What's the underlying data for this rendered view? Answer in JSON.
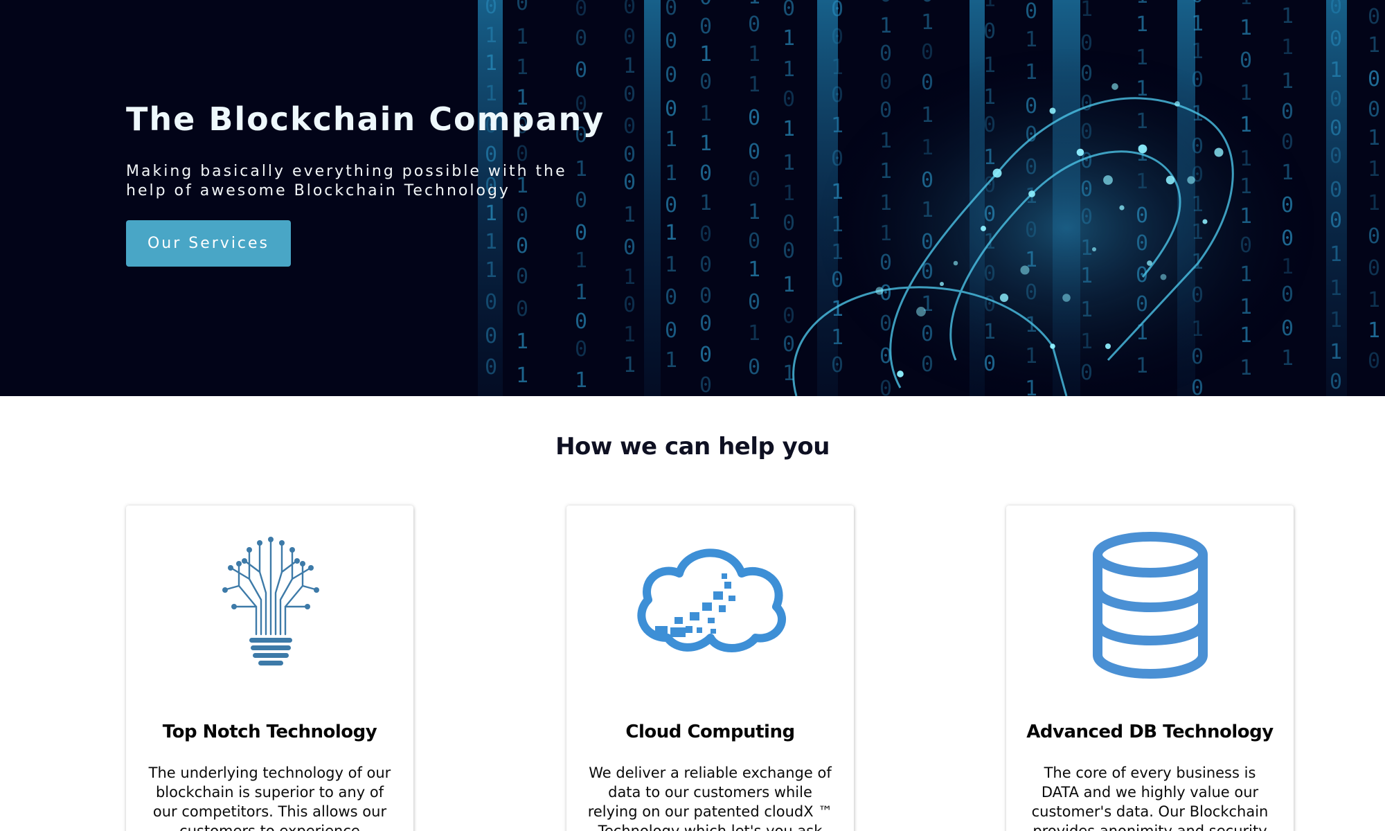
{
  "hero": {
    "title": "The Blockchain Company",
    "subtitle": "Making basically everything possible with the help of awesome Blockchain Technology",
    "button_label": "Our Services"
  },
  "services": {
    "heading": "How we can help you",
    "cards": [
      {
        "icon": "lightbulb-circuit-icon",
        "title": "Top Notch Technology",
        "text": "The underlying technology of our blockchain is superior to any of our competitors. This allows our customers to experience"
      },
      {
        "icon": "cloud-icon",
        "title": "Cloud Computing",
        "text": "We deliver a reliable exchange of data to our customers while relying on our patented cloudX ™ Technology which let's you ask"
      },
      {
        "icon": "database-icon",
        "title": "Advanced DB Technology",
        "text": "The core of every business is DATA and we highly value our customer's data. Our Blockchain provides anonimity and security"
      }
    ]
  },
  "colors": {
    "hero_background": "#020418",
    "accent": "#49a6c6",
    "icon_blue": "#4a90d4"
  }
}
